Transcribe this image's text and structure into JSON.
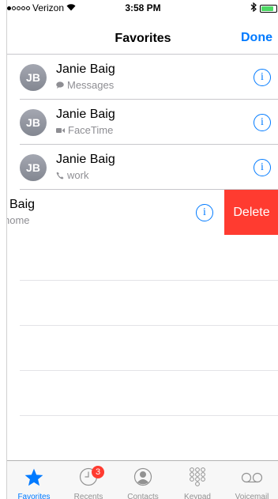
{
  "status_bar": {
    "signal_filled": 1,
    "signal_total": 5,
    "carrier": "Verizon",
    "time": "3:58 PM",
    "battery_level": 0.85
  },
  "nav": {
    "title": "Favorites",
    "done_label": "Done"
  },
  "favorites": [
    {
      "initials": "JB",
      "name": "Janie Baig",
      "type": "Messages",
      "icon": "message-bubble-icon"
    },
    {
      "initials": "JB",
      "name": "Janie Baig",
      "type": "FaceTime",
      "icon": "video-camera-icon"
    },
    {
      "initials": "JB",
      "name": "Janie Baig",
      "type": "work",
      "icon": "phone-icon"
    }
  ],
  "swiped_row": {
    "name_visible": "Baig",
    "type_visible": "home",
    "delete_label": "Delete"
  },
  "tab_bar": {
    "tabs": [
      {
        "label": "Favorites",
        "icon": "star-icon",
        "active": true
      },
      {
        "label": "Recents",
        "icon": "clock-icon",
        "badge": "3"
      },
      {
        "label": "Contacts",
        "icon": "contacts-icon"
      },
      {
        "label": "Keypad",
        "icon": "keypad-icon"
      },
      {
        "label": "Voicemail",
        "icon": "voicemail-icon"
      }
    ]
  },
  "colors": {
    "accent": "#007aff",
    "delete": "#ff3b30",
    "battery": "#4cd964",
    "badge": "#ff3b30",
    "secondary_text": "#8e8e93"
  }
}
